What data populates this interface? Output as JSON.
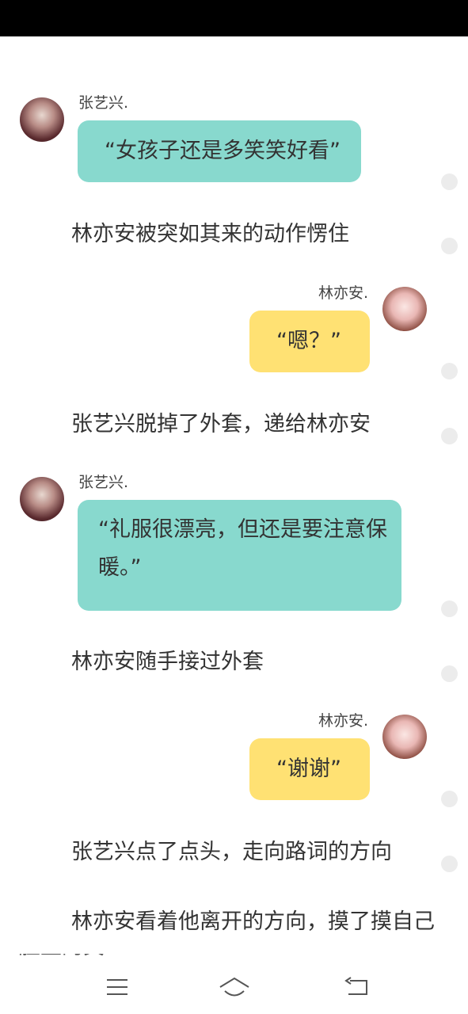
{
  "messages": [
    {
      "type": "left",
      "name": "张艺兴.",
      "text": "“女孩子还是多笑笑好看”"
    },
    {
      "type": "narration",
      "text": "林亦安被突如其来的动作愣住"
    },
    {
      "type": "right",
      "name": "林亦安.",
      "text": "“嗯？”"
    },
    {
      "type": "narration",
      "text": "张艺兴脱掉了外套，递给林亦安"
    },
    {
      "type": "left",
      "name": "张艺兴.",
      "line1": "“礼服很漂亮，但还是要注意保",
      "line2": "暖。”"
    },
    {
      "type": "narration",
      "text": "林亦安随手接过外套"
    },
    {
      "type": "right",
      "name": "林亦安.",
      "text": "“谢谢”"
    },
    {
      "type": "narration",
      "text": "张艺兴点了点头，走向路词的方向"
    },
    {
      "type": "narration",
      "text": "林亦安看着他离开的方向，摸了摸自己"
    },
    {
      "type": "narration",
      "text": "脸上的笑容"
    }
  ],
  "colors": {
    "teal_bubble": "#88d9ce",
    "yellow_bubble": "#ffe173",
    "status_bar": "#000000"
  },
  "nav": {
    "menu_icon": "menu-icon",
    "home_icon": "home-icon",
    "back_icon": "back-icon"
  }
}
